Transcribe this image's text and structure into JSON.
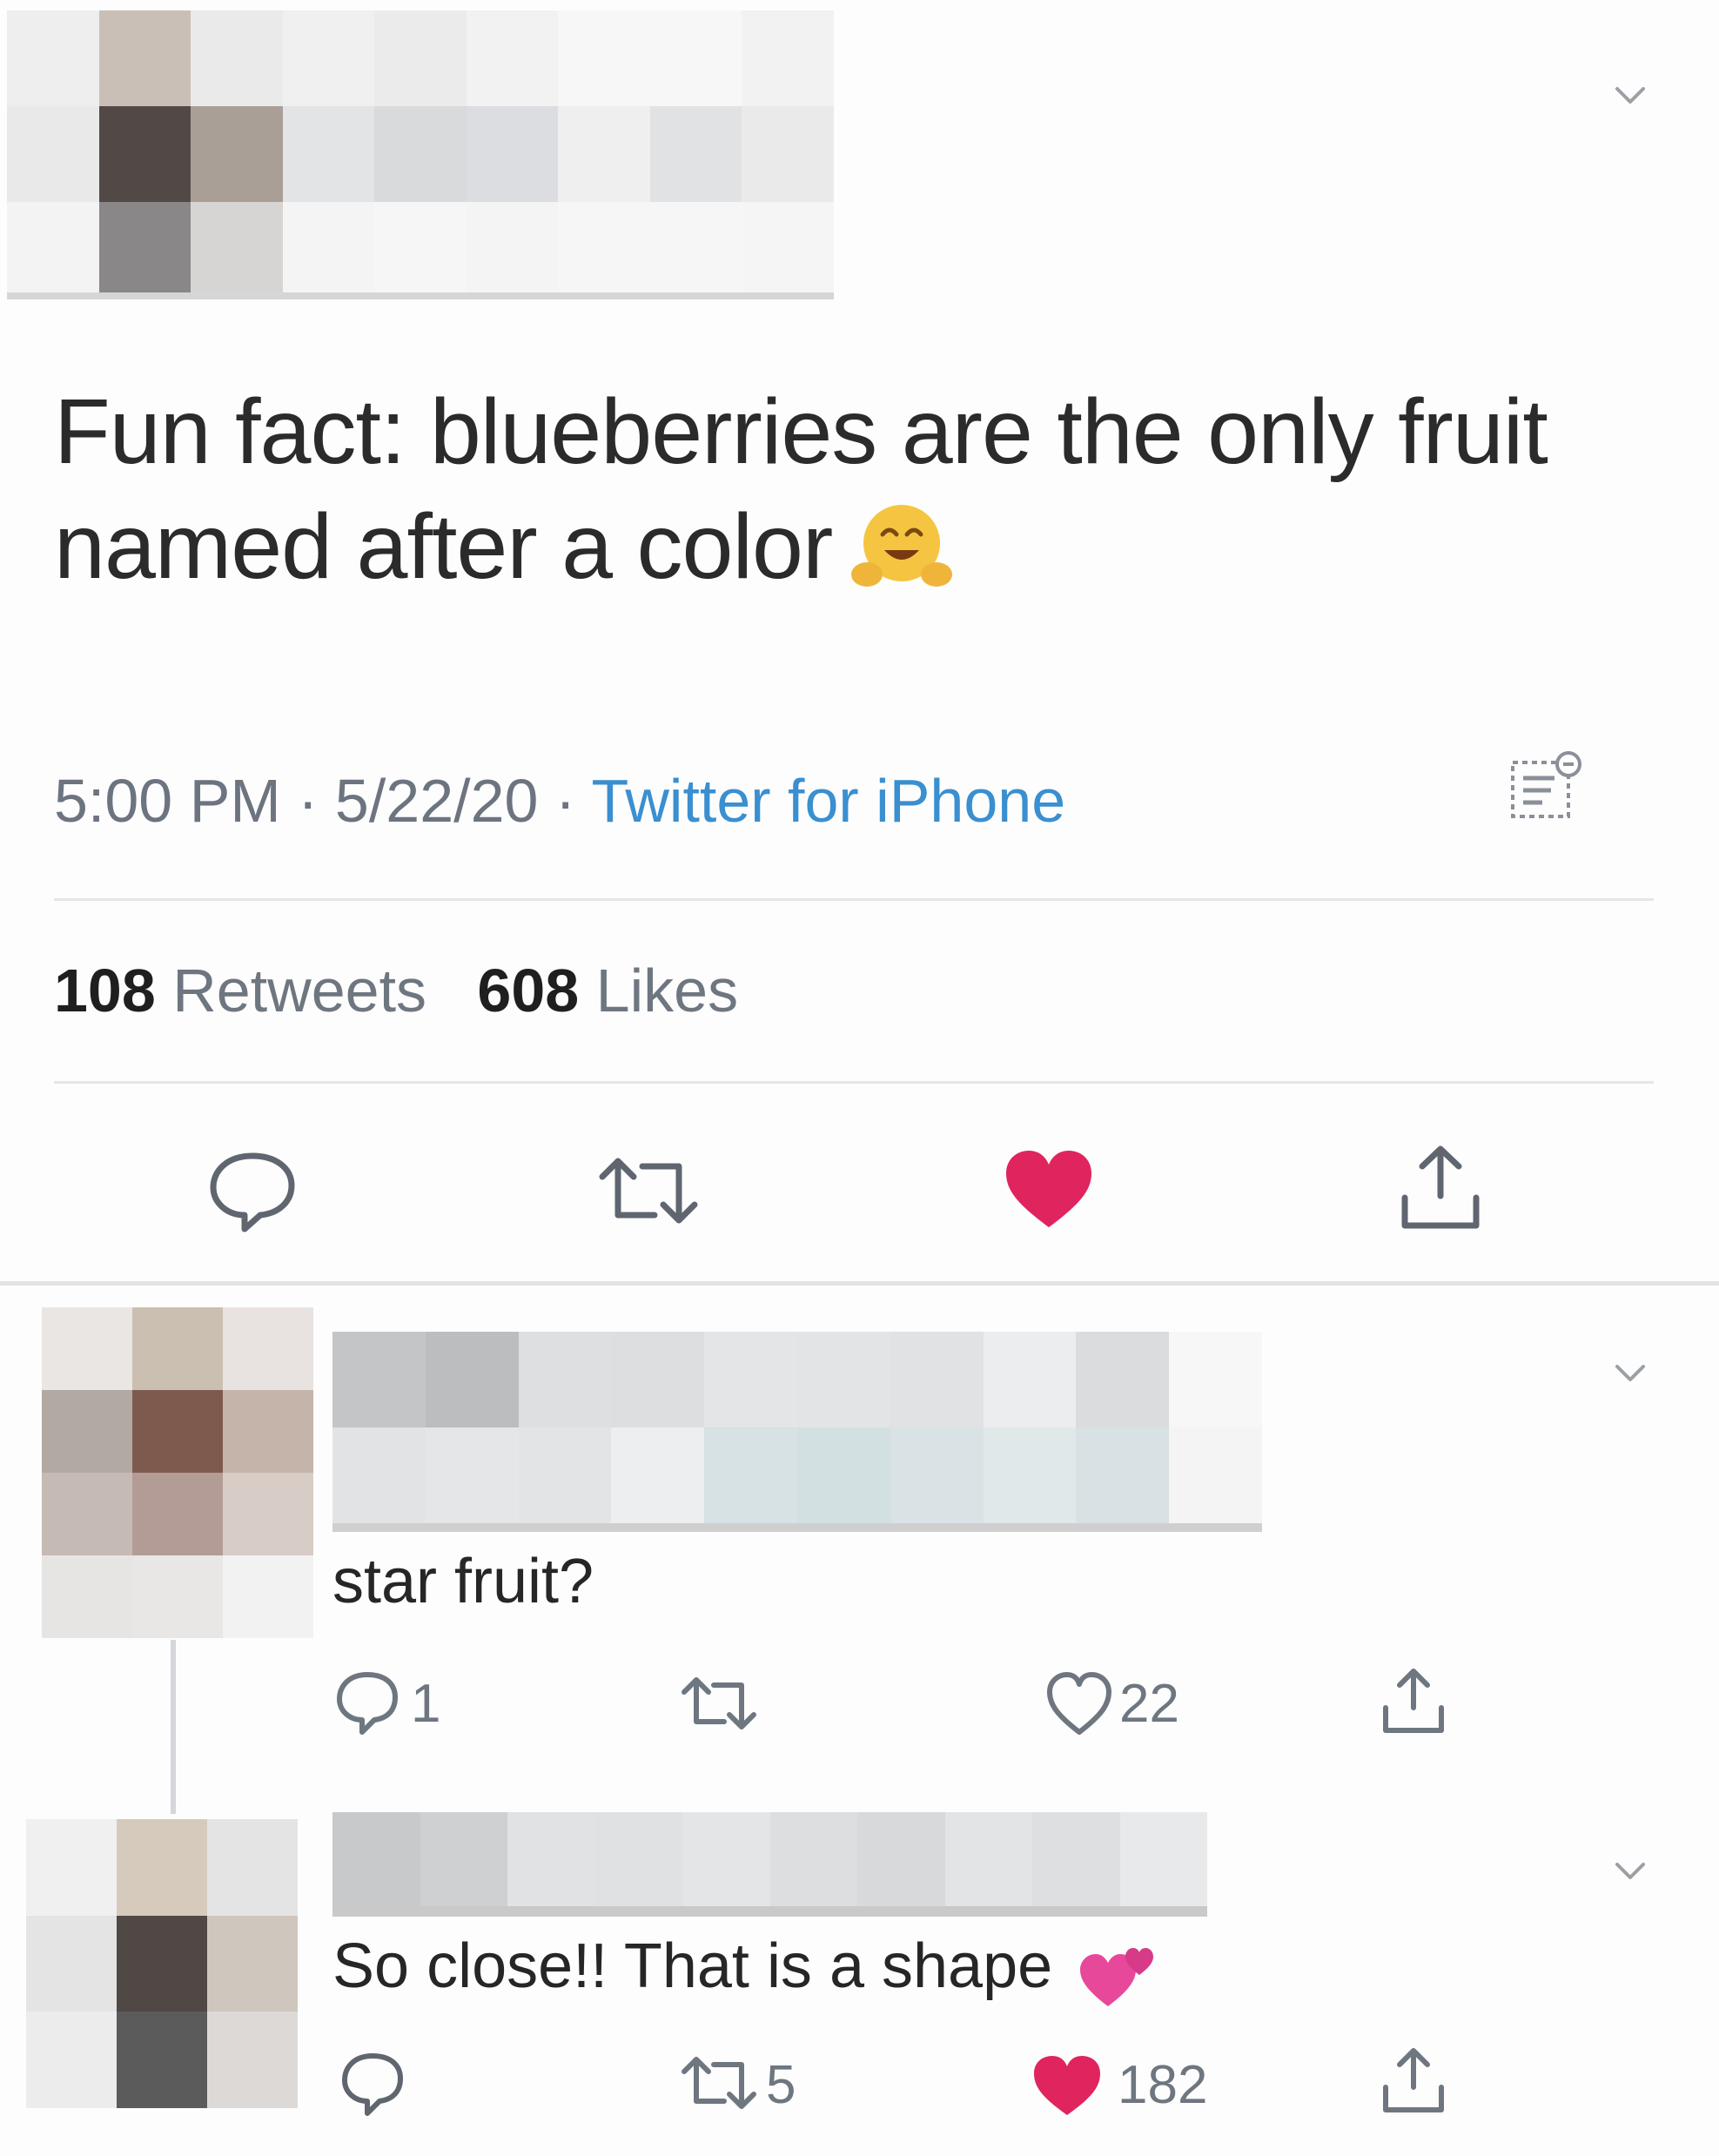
{
  "main_tweet": {
    "text_line1": "Fun fact: blueberries are the only fruit",
    "text_line2": "named after a color",
    "emoji": "hugging-face-emoji",
    "time": "5:00 PM",
    "date": "5/22/20",
    "client": "Twitter for iPhone",
    "separator": "·",
    "retweets_count": "108",
    "retweets_label": "Retweets",
    "likes_count": "608",
    "likes_label": "Likes",
    "liked": true
  },
  "replies": [
    {
      "text": "star fruit?",
      "reply_count": "1",
      "retweet_count": "",
      "like_count": "22",
      "liked": false
    },
    {
      "text": "So close!! That is a shape",
      "emoji": "two-hearts-emoji",
      "reply_count": "",
      "retweet_count": "5",
      "like_count": "182",
      "liked": true
    }
  ],
  "colors": {
    "like_red": "#e0245e",
    "link_blue": "#3a8fd0",
    "icon_gray": "#6e7680"
  }
}
